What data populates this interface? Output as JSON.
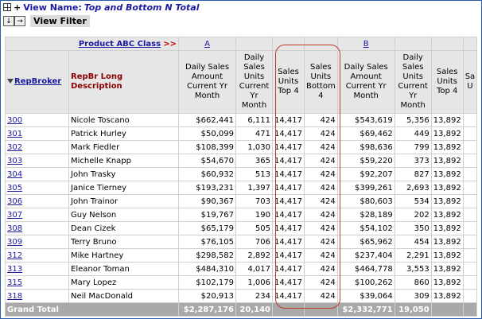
{
  "title": {
    "label": "View Name:",
    "name": "Top and Bottom N Total"
  },
  "toolbar": {
    "btn1": "↓",
    "btn2": "→",
    "view_filter": "View Filter"
  },
  "class_row": {
    "label": "Product ABC Class",
    "arrows": ">>",
    "class_a": "A",
    "class_b": "B"
  },
  "columns": {
    "repbroker": "RepBroker",
    "desc": "RepBr Long Description",
    "a_amount": "Daily Sales Amount Current Yr Month",
    "a_units": "Daily Sales Units Current Yr Month",
    "a_top": "Sales Units Top 4",
    "a_bottom": "Sales Units Bottom 4",
    "b_amount": "Daily Sales Amount Current Yr Month",
    "b_units": "Daily Sales Units Current Yr Month",
    "b_top": "Sales Units Top 4",
    "b_bottom": "Sa U"
  },
  "rows": [
    {
      "id": "300",
      "name": "Nicole Toscano",
      "a_amt": "$662,441",
      "a_units": "6,111",
      "a_top": "14,417",
      "a_bot": "424",
      "b_amt": "$543,619",
      "b_units": "5,356",
      "b_top": "13,892"
    },
    {
      "id": "301",
      "name": "Patrick Hurley",
      "a_amt": "$50,099",
      "a_units": "471",
      "a_top": "14,417",
      "a_bot": "424",
      "b_amt": "$69,462",
      "b_units": "449",
      "b_top": "13,892"
    },
    {
      "id": "302",
      "name": "Mark Fiedler",
      "a_amt": "$108,399",
      "a_units": "1,030",
      "a_top": "14,417",
      "a_bot": "424",
      "b_amt": "$98,636",
      "b_units": "799",
      "b_top": "13,892"
    },
    {
      "id": "303",
      "name": "Michelle Knapp",
      "a_amt": "$54,670",
      "a_units": "365",
      "a_top": "14,417",
      "a_bot": "424",
      "b_amt": "$59,220",
      "b_units": "373",
      "b_top": "13,892"
    },
    {
      "id": "304",
      "name": "John Trasky",
      "a_amt": "$60,932",
      "a_units": "513",
      "a_top": "14,417",
      "a_bot": "424",
      "b_amt": "$92,207",
      "b_units": "827",
      "b_top": "13,892"
    },
    {
      "id": "305",
      "name": "Janice Tierney",
      "a_amt": "$193,231",
      "a_units": "1,397",
      "a_top": "14,417",
      "a_bot": "424",
      "b_amt": "$399,261",
      "b_units": "2,693",
      "b_top": "13,892"
    },
    {
      "id": "306",
      "name": "John Trainor",
      "a_amt": "$90,367",
      "a_units": "703",
      "a_top": "14,417",
      "a_bot": "424",
      "b_amt": "$80,603",
      "b_units": "534",
      "b_top": "13,892"
    },
    {
      "id": "307",
      "name": "Guy Nelson",
      "a_amt": "$19,767",
      "a_units": "190",
      "a_top": "14,417",
      "a_bot": "424",
      "b_amt": "$28,189",
      "b_units": "202",
      "b_top": "13,892"
    },
    {
      "id": "308",
      "name": "Dean Cizek",
      "a_amt": "$65,179",
      "a_units": "505",
      "a_top": "14,417",
      "a_bot": "424",
      "b_amt": "$54,102",
      "b_units": "350",
      "b_top": "13,892"
    },
    {
      "id": "309",
      "name": "Terry Bruno",
      "a_amt": "$76,105",
      "a_units": "706",
      "a_top": "14,417",
      "a_bot": "424",
      "b_amt": "$65,962",
      "b_units": "454",
      "b_top": "13,892"
    },
    {
      "id": "312",
      "name": "Mike Hartney",
      "a_amt": "$298,582",
      "a_units": "2,892",
      "a_top": "14,417",
      "a_bot": "424",
      "b_amt": "$237,404",
      "b_units": "2,291",
      "b_top": "13,892"
    },
    {
      "id": "313",
      "name": "Eleanor Toman",
      "a_amt": "$484,310",
      "a_units": "4,017",
      "a_top": "14,417",
      "a_bot": "424",
      "b_amt": "$464,778",
      "b_units": "3,553",
      "b_top": "13,892"
    },
    {
      "id": "315",
      "name": "Mary Lopez",
      "a_amt": "$102,179",
      "a_units": "1,006",
      "a_top": "14,417",
      "a_bot": "424",
      "b_amt": "$100,262",
      "b_units": "860",
      "b_top": "13,892"
    },
    {
      "id": "318",
      "name": "Neil MacDonald",
      "a_amt": "$20,913",
      "a_units": "234",
      "a_top": "14,417",
      "a_bot": "424",
      "b_amt": "$39,064",
      "b_units": "309",
      "b_top": "13,892"
    }
  ],
  "total": {
    "label": "Grand Total",
    "a_amt": "$2,287,176",
    "a_units": "20,140",
    "b_amt": "$2,332,771",
    "b_units": "19,050"
  },
  "colors": {
    "link": "#1a1aa0",
    "highlight": "#c0392b",
    "total_bg": "#a9a9a9"
  }
}
